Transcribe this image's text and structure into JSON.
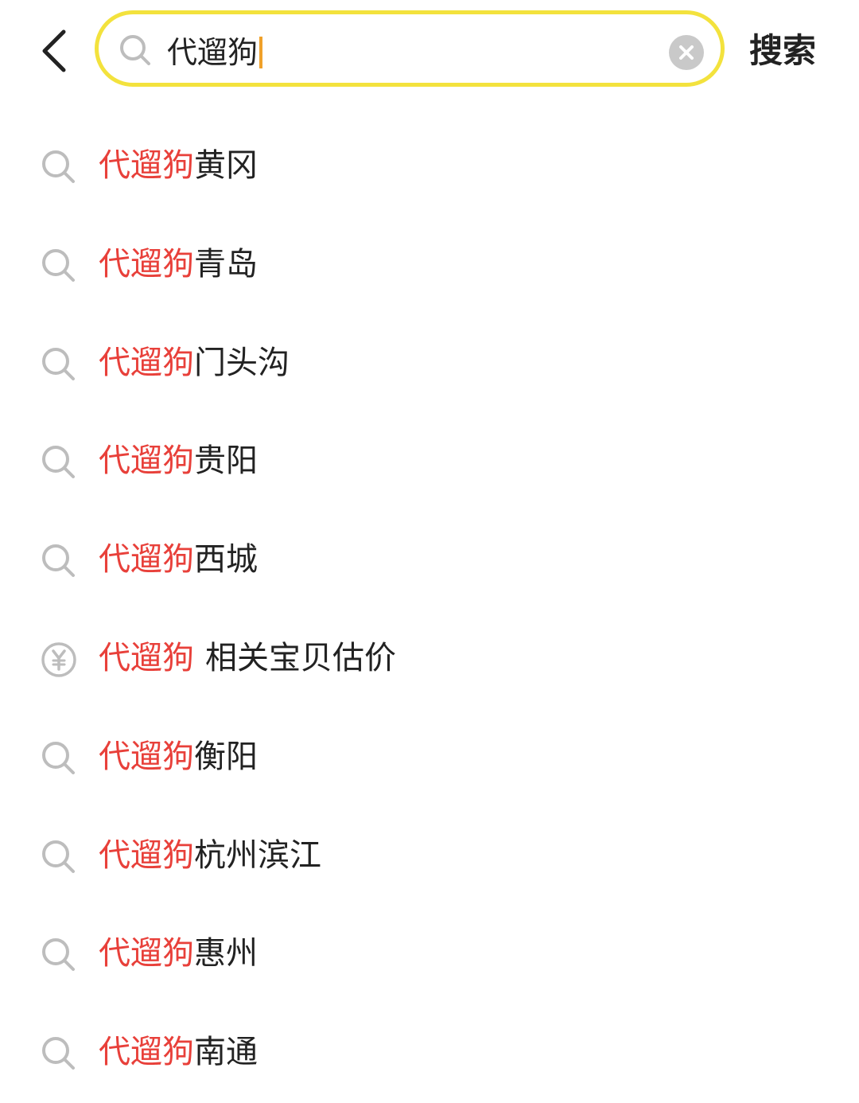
{
  "header": {
    "search_value": "代遛狗",
    "search_button_label": "搜索"
  },
  "accent_color": "#f3e23d",
  "highlight_color": "#e8403a",
  "suggestions": [
    {
      "icon": "search-icon",
      "keyword": "代遛狗",
      "rest": "黄冈"
    },
    {
      "icon": "search-icon",
      "keyword": "代遛狗",
      "rest": "青岛"
    },
    {
      "icon": "search-icon",
      "keyword": "代遛狗",
      "rest": "门头沟"
    },
    {
      "icon": "search-icon",
      "keyword": "代遛狗",
      "rest": "贵阳"
    },
    {
      "icon": "search-icon",
      "keyword": "代遛狗",
      "rest": "西城"
    },
    {
      "icon": "yen-circle-icon",
      "keyword": "代遛狗",
      "rest": "相关宝贝估价"
    },
    {
      "icon": "search-icon",
      "keyword": "代遛狗",
      "rest": "衡阳"
    },
    {
      "icon": "search-icon",
      "keyword": "代遛狗",
      "rest": "杭州滨江"
    },
    {
      "icon": "search-icon",
      "keyword": "代遛狗",
      "rest": "惠州"
    },
    {
      "icon": "search-icon",
      "keyword": "代遛狗",
      "rest": "南通"
    }
  ]
}
